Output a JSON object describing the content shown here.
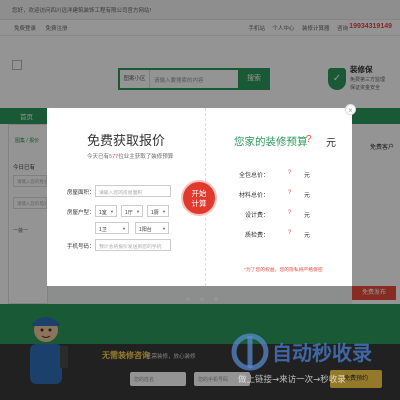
{
  "topbar": {
    "welcome": "您好，欢迎访问四川远洋建筑装饰工程有限公司官方网站!"
  },
  "userbar": {
    "login": "免费登录",
    "register": "免费注册",
    "links": [
      "手机站",
      "个人中心",
      "装修计算器",
      "咨询"
    ],
    "phone": "19934319149"
  },
  "header": {
    "search_category": "图案小区",
    "search_placeholder": "请输入要搜索的内容",
    "search_button": "搜索",
    "guarantee_title": "装修保",
    "guarantee_line1": "免费第三方监理",
    "guarantee_line2": "保证资金安全"
  },
  "nav": {
    "home": "首页"
  },
  "left_panel": {
    "tab": "图集 / 报价",
    "today": "今日已有",
    "input1": "请输入您的姓名",
    "input2": "请输入您的电话",
    "select": "一装一"
  },
  "right_panel": {
    "title": "免费客户",
    "button": "免费发布"
  },
  "bottombar": {
    "title": "无需装修咨询",
    "subtitle": "无需装修，放心装修",
    "name_placeholder": "您的姓名",
    "phone_placeholder": "您的手机号码",
    "button": "免费预约"
  },
  "modal": {
    "title": "免费获取报价",
    "subtitle_prefix": "今天已有",
    "subtitle_count": "577",
    "subtitle_suffix": "位业主获取了装修预算",
    "area_label": "房屋面积：",
    "area_placeholder": "请输入您的房屋面积",
    "type_label": "房屋户型：",
    "room_options": [
      "1室",
      "1厅",
      "1厨"
    ],
    "bath_options": [
      "1卫",
      "1阳台"
    ],
    "phone_label": "手机号码：",
    "phone_placeholder": "预计会将报价发送到您的手机",
    "calc_button_line1": "开始",
    "calc_button_line2": "计算",
    "close": "×"
  },
  "budget": {
    "title": "您家的装修预算",
    "value": "?",
    "unit": "元",
    "rows": [
      {
        "label": "全包总价：",
        "value": "?",
        "unit": "元"
      },
      {
        "label": "材料总价：",
        "value": "?",
        "unit": "元"
      },
      {
        "label": "设计费：",
        "value": "?",
        "unit": "元"
      },
      {
        "label": "质检费：",
        "value": "?",
        "unit": "元"
      }
    ],
    "note": "*为了您的权益，您的隐私将严格保密"
  },
  "watermark": {
    "text1": "自动秒收录",
    "text2": "做上链接→来访一次→秒收录"
  },
  "colors": {
    "brand_green": "#2e9a5e",
    "accent_red": "#e84c3d",
    "phone_red": "#e04848",
    "bottom_yellow": "#ffd14a"
  }
}
